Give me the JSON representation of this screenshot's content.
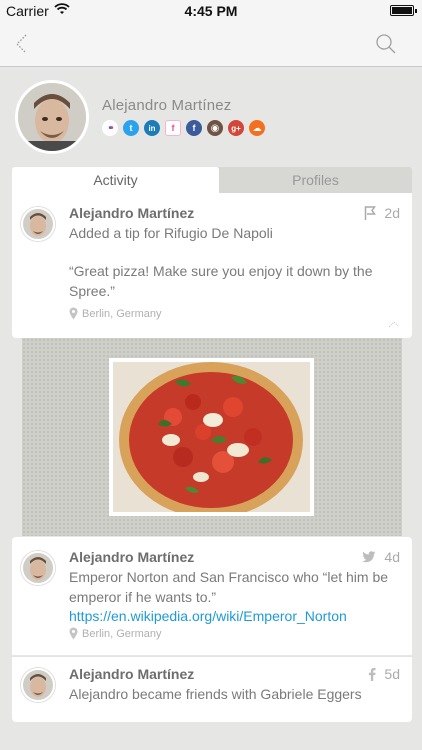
{
  "status_bar": {
    "carrier": "Carrier",
    "time": "4:45 PM"
  },
  "profile": {
    "name": "Alejandro Martínez",
    "socials": [
      {
        "icon": "flickr-icon",
        "glyph": "••",
        "color": "#ffffff",
        "fg": "#e03a8b"
      },
      {
        "icon": "twitter-icon",
        "glyph": "t",
        "color": "#2aa3ef"
      },
      {
        "icon": "linkedin-icon",
        "glyph": "in",
        "color": "#1c7bb9"
      },
      {
        "icon": "foursquare-icon",
        "glyph": "f",
        "color": "#ffffff",
        "fg": "#f0508c"
      },
      {
        "icon": "facebook-icon",
        "glyph": "f",
        "color": "#3b5b9a"
      },
      {
        "icon": "instagram-icon",
        "glyph": "◉",
        "color": "#6f5443"
      },
      {
        "icon": "google-plus-icon",
        "glyph": "g+",
        "color": "#d3463a"
      },
      {
        "icon": "soundcloud-icon",
        "glyph": "☁",
        "color": "#f5701e"
      }
    ]
  },
  "tabs": {
    "activity": "Activity",
    "profiles": "Profiles"
  },
  "feed": [
    {
      "author": "Alejandro Martínez",
      "source_icon": "foursquare-flag-icon",
      "age": "2d",
      "message": "Added a tip for Rifugio De Napoli",
      "quote": "“Great pizza! Make sure you enjoy it down by the Spree.”",
      "location": "Berlin, Germany"
    },
    {
      "author": "Alejandro Martínez",
      "source_icon": "twitter-bird-icon",
      "age": "4d",
      "message": "Emperor Norton and San Francisco who “let him be emperor if he wants to.”",
      "link": "https://en.wikipedia.org/wiki/Emperor_Norton",
      "location": "Berlin, Germany"
    },
    {
      "author": "Alejandro Martínez",
      "source_icon": "facebook-icon",
      "age": "5d",
      "message": "Alejandro became friends with Gabriele Eggers"
    }
  ],
  "colors": {
    "link": "#1e9ad6",
    "background": "#e6e6e4"
  }
}
